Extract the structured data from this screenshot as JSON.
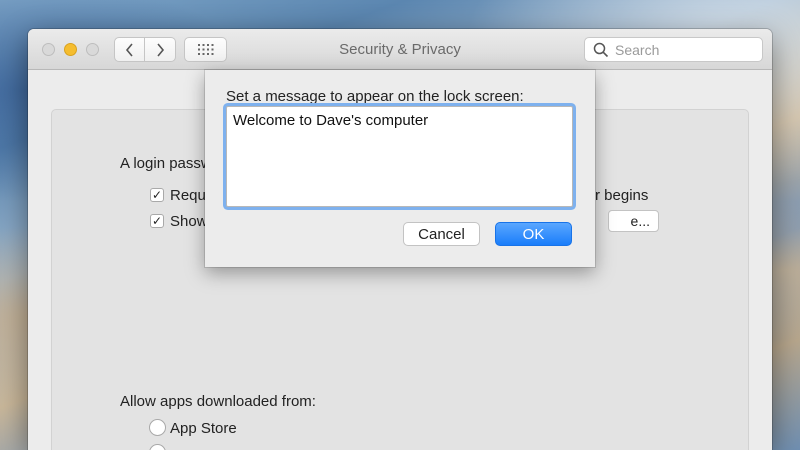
{
  "window": {
    "title": "Security & Privacy"
  },
  "search": {
    "placeholder": "Search"
  },
  "panel": {
    "login_text": "A login passw",
    "require_label": "Requi",
    "require_tail": "r begins",
    "show_label": "Show",
    "set_button_tail": "e...",
    "allow_apps_label": "Allow apps downloaded from:",
    "radio_app_store": "App Store"
  },
  "sheet": {
    "prompt": "Set a message to appear on the lock screen:",
    "message_value": "Welcome to Dave's computer",
    "cancel_label": "Cancel",
    "ok_label": "OK"
  },
  "colors": {
    "accent": "#1a7dfa",
    "minimize": "#f5bd2f"
  }
}
